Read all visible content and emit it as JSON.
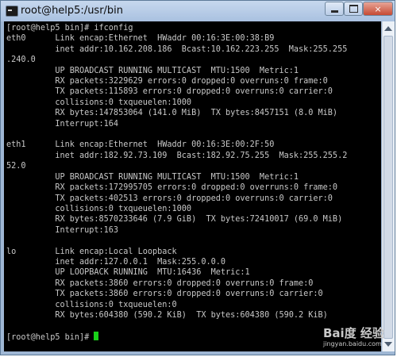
{
  "window": {
    "title": "root@help5:/usr/bin",
    "controls": {
      "minimize": "minimize-icon",
      "maximize": "maximize-icon",
      "close": "×"
    }
  },
  "terminal": {
    "lines": [
      "[root@help5 bin]# ifconfig",
      "eth0      Link encap:Ethernet  HWaddr 00:16:3E:00:38:B9",
      "          inet addr:10.162.208.186  Bcast:10.162.223.255  Mask:255.255",
      ".240.0",
      "          UP BROADCAST RUNNING MULTICAST  MTU:1500  Metric:1",
      "          RX packets:3229629 errors:0 dropped:0 overruns:0 frame:0",
      "          TX packets:115893 errors:0 dropped:0 overruns:0 carrier:0",
      "          collisions:0 txqueuelen:1000",
      "          RX bytes:147853064 (141.0 MiB)  TX bytes:8457151 (8.0 MiB)",
      "          Interrupt:164",
      "",
      "eth1      Link encap:Ethernet  HWaddr 00:16:3E:00:2F:50",
      "          inet addr:182.92.73.109  Bcast:182.92.75.255  Mask:255.255.2",
      "52.0",
      "          UP BROADCAST RUNNING MULTICAST  MTU:1500  Metric:1",
      "          RX packets:172995705 errors:0 dropped:0 overruns:0 frame:0",
      "          TX packets:402513 errors:0 dropped:0 overruns:0 carrier:0",
      "          collisions:0 txqueuelen:1000",
      "          RX bytes:8570233646 (7.9 GiB)  TX bytes:72410017 (69.0 MiB)",
      "          Interrupt:163",
      "",
      "lo        Link encap:Local Loopback",
      "          inet addr:127.0.0.1  Mask:255.0.0.0",
      "          UP LOOPBACK RUNNING  MTU:16436  Metric:1",
      "          RX packets:3860 errors:0 dropped:0 overruns:0 frame:0",
      "          TX packets:3860 errors:0 dropped:0 overruns:0 carrier:0",
      "          collisions:0 txqueuelen:0",
      "          RX bytes:604380 (590.2 KiB)  TX bytes:604380 (590.2 KiB)",
      ""
    ],
    "prompt": "[root@help5 bin]# ",
    "cursor_color": "#19d219",
    "text_color": "#c8c8c8",
    "background_color": "#000000"
  },
  "watermark": {
    "logo": "Bai度 经验",
    "url": "jingyan.baidu.com"
  }
}
